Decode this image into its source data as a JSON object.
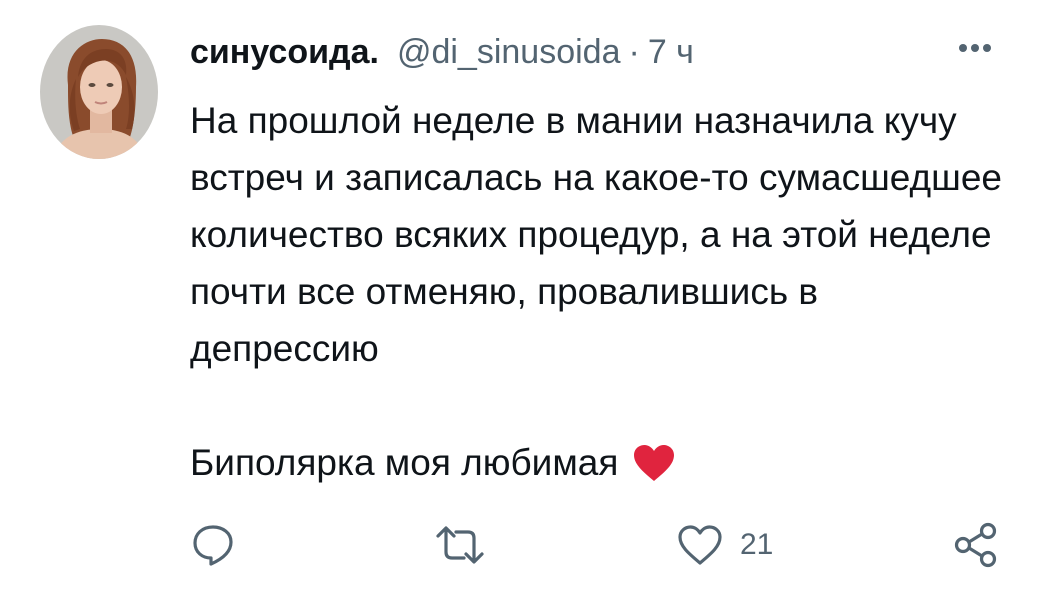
{
  "tweet": {
    "display_name": "синусоида.",
    "handle": "@di_sinusoida",
    "separator": "·",
    "time": "7 ч",
    "body_paragraph_1": "На прошлой неделе в мании назначила кучу встреч и записалась на какое-то сумасшедшее количество всяких процедур, а на этой неделе почти все отменяю, провалившись в депрессию",
    "body_paragraph_2": "Биполярка моя любимая",
    "emoji": "red-heart-icon"
  },
  "actions": {
    "reply": {
      "icon": "reply-icon"
    },
    "retweet": {
      "icon": "retweet-icon"
    },
    "like": {
      "icon": "like-heart-icon",
      "count": "21"
    },
    "share": {
      "icon": "share-icon"
    }
  },
  "colors": {
    "text_primary": "#0f1419",
    "text_secondary": "#536471",
    "heart_red": "#e0243e"
  }
}
